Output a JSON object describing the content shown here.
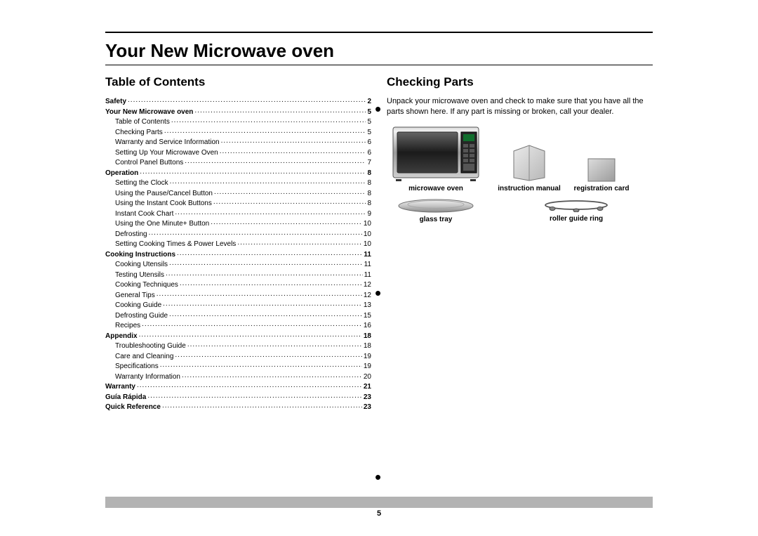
{
  "page_title": "Your New Microwave oven",
  "page_number": "5",
  "toc_heading": "Table of Contents",
  "toc": [
    {
      "label": "Safety",
      "page": "2",
      "level": 0,
      "bold": true
    },
    {
      "label": "Your New Microwave oven",
      "page": "5",
      "level": 0,
      "bold": true
    },
    {
      "label": "Table of Contents",
      "page": "5",
      "level": 1,
      "bold": false
    },
    {
      "label": "Checking Parts",
      "page": "5",
      "level": 1,
      "bold": false
    },
    {
      "label": "Warranty and Service Information",
      "page": "6",
      "level": 1,
      "bold": false
    },
    {
      "label": "Setting Up Your Microwave Oven",
      "page": "6",
      "level": 1,
      "bold": false
    },
    {
      "label": "Control Panel Buttons",
      "page": "7",
      "level": 1,
      "bold": false
    },
    {
      "label": "Operation",
      "page": "8",
      "level": 0,
      "bold": true
    },
    {
      "label": "Setting the Clock",
      "page": "8",
      "level": 1,
      "bold": false
    },
    {
      "label": "Using the Pause/Cancel Button",
      "page": "8",
      "level": 1,
      "bold": false
    },
    {
      "label": "Using the Instant Cook Buttons",
      "page": "8",
      "level": 1,
      "bold": false
    },
    {
      "label": "Instant Cook Chart",
      "page": "9",
      "level": 1,
      "bold": false
    },
    {
      "label": "Using the One Minute+ Button",
      "page": "10",
      "level": 1,
      "bold": false
    },
    {
      "label": "Defrosting",
      "page": "10",
      "level": 1,
      "bold": false
    },
    {
      "label": "Setting Cooking Times & Power Levels",
      "page": "10",
      "level": 1,
      "bold": false
    },
    {
      "label": "Cooking Instructions",
      "page": "11",
      "level": 0,
      "bold": true
    },
    {
      "label": "Cooking Utensils",
      "page": "11",
      "level": 1,
      "bold": false
    },
    {
      "label": "Testing Utensils",
      "page": "11",
      "level": 1,
      "bold": false
    },
    {
      "label": "Cooking Techniques",
      "page": "12",
      "level": 1,
      "bold": false
    },
    {
      "label": "General Tips",
      "page": "12",
      "level": 1,
      "bold": false
    },
    {
      "label": "Cooking Guide",
      "page": "13",
      "level": 1,
      "bold": false
    },
    {
      "label": "Defrosting Guide",
      "page": "15",
      "level": 1,
      "bold": false
    },
    {
      "label": "Recipes",
      "page": "16",
      "level": 1,
      "bold": false
    },
    {
      "label": "Appendix",
      "page": "18",
      "level": 0,
      "bold": true
    },
    {
      "label": "Troubleshooting Guide",
      "page": "18",
      "level": 1,
      "bold": false
    },
    {
      "label": "Care and Cleaning",
      "page": "19",
      "level": 1,
      "bold": false
    },
    {
      "label": "Specifications",
      "page": "19",
      "level": 1,
      "bold": false
    },
    {
      "label": "Warranty Information",
      "page": "20",
      "level": 1,
      "bold": false
    },
    {
      "label": "Warranty",
      "page": "21",
      "level": 0,
      "bold": true
    },
    {
      "label": "Guía Rápida",
      "page": "23",
      "level": 0,
      "bold": true
    },
    {
      "label": "Quick Reference",
      "page": "23",
      "level": 0,
      "bold": true
    }
  ],
  "checking": {
    "heading": "Checking Parts",
    "intro": "Unpack your microwave oven and check to make sure that you have all the parts shown here. If any part is missing or broken, call your dealer.",
    "parts": {
      "oven": "microwave oven",
      "manual": "instruction manual",
      "card": "registration card",
      "tray": "glass tray",
      "ring": "roller guide ring"
    }
  }
}
